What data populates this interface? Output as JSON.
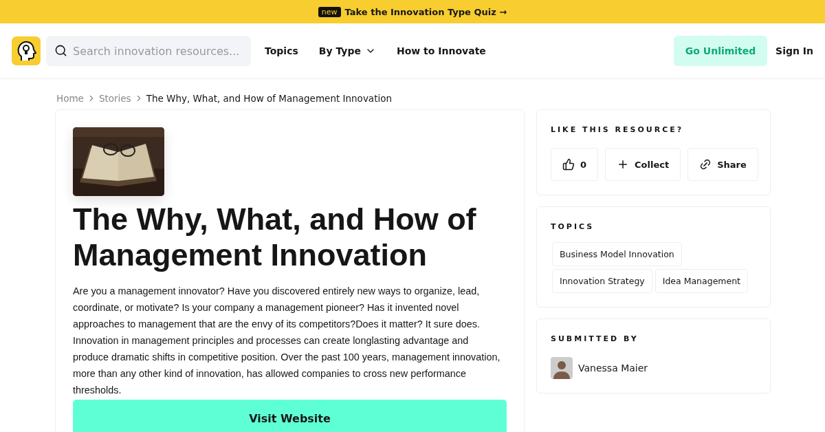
{
  "banner": {
    "badge": "new",
    "text": "Take the Innovation Type Quiz →"
  },
  "header": {
    "search": {
      "placeholder": "Search innovation resources..."
    },
    "nav": [
      {
        "label": "Topics",
        "kind": "link"
      },
      {
        "label": "By Type",
        "kind": "dropdown"
      },
      {
        "label": "How to Innovate",
        "kind": "link"
      }
    ],
    "cta": "Go Unlimited",
    "sign_in": "Sign In"
  },
  "breadcrumb": [
    "Home",
    "Stories",
    "The Why, What, and How of Management Innovation"
  ],
  "article": {
    "title": "The Why, What, and How of Management Innovation",
    "body": "Are you a management innovator? Have you discovered entirely new ways to organize, lead, coordinate, or motivate? Is your company a management pioneer? Has it invented novel approaches to management that are the envy of its competitors?Does it matter? It sure does. Innovation in management principles and processes can create longlasting advantage and produce dramatic shifts in competitive position. Over the past 100 years, management innovation, more than any other kind of innovation, has allowed companies to cross new performance thresholds.",
    "button": "Visit Website"
  },
  "like_panel": {
    "heading": "LIKE THIS RESOURCE?",
    "actions": [
      {
        "kind": "like",
        "label": "0"
      },
      {
        "kind": "collect",
        "label": "Collect"
      },
      {
        "kind": "share",
        "label": "Share"
      }
    ]
  },
  "topics_panel": {
    "heading": "TOPICS",
    "tags": [
      "Business Model Innovation",
      "Innovation Strategy",
      "Idea Management"
    ]
  },
  "submitted_panel": {
    "heading": "SUBMITTED BY",
    "name": "Vanessa Maier"
  }
}
